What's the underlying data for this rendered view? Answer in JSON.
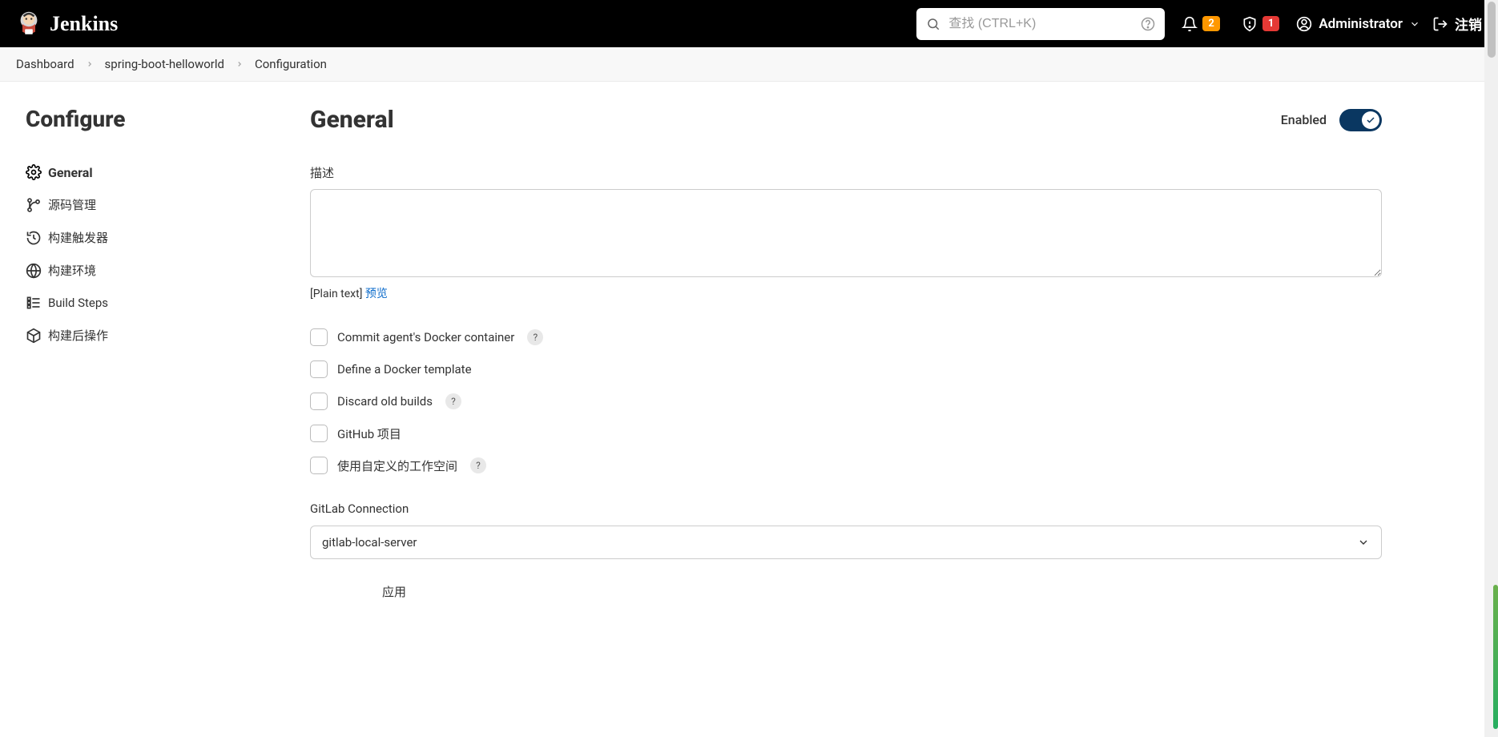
{
  "header": {
    "brand": "Jenkins",
    "search_placeholder": "查找 (CTRL+K)",
    "notification_count": "2",
    "alert_count": "1",
    "username": "Administrator",
    "logout_label": "注销"
  },
  "breadcrumbs": {
    "items": [
      "Dashboard",
      "spring-boot-helloworld",
      "Configuration"
    ]
  },
  "sidebar": {
    "title": "Configure",
    "items": [
      {
        "label": "General",
        "icon": "gear"
      },
      {
        "label": "源码管理",
        "icon": "branch"
      },
      {
        "label": "构建触发器",
        "icon": "clock"
      },
      {
        "label": "构建环境",
        "icon": "globe"
      },
      {
        "label": "Build Steps",
        "icon": "steps"
      },
      {
        "label": "构建后操作",
        "icon": "cube"
      }
    ]
  },
  "main": {
    "title": "General",
    "enabled_label": "Enabled",
    "enabled": true,
    "description_label": "描述",
    "description_value": "",
    "format_text": "[Plain text]",
    "preview_label": "预览",
    "checkboxes": [
      {
        "label": "Commit agent's Docker container",
        "help": true
      },
      {
        "label": "Define a Docker template",
        "help": false
      },
      {
        "label": "Discard old builds",
        "help": true
      },
      {
        "label": "GitHub 项目",
        "help": false
      },
      {
        "label": "使用自定义的工作空间",
        "help": true
      }
    ],
    "gitlab_label": "GitLab Connection",
    "gitlab_value": "gitlab-local-server",
    "apply_label": "应用"
  }
}
